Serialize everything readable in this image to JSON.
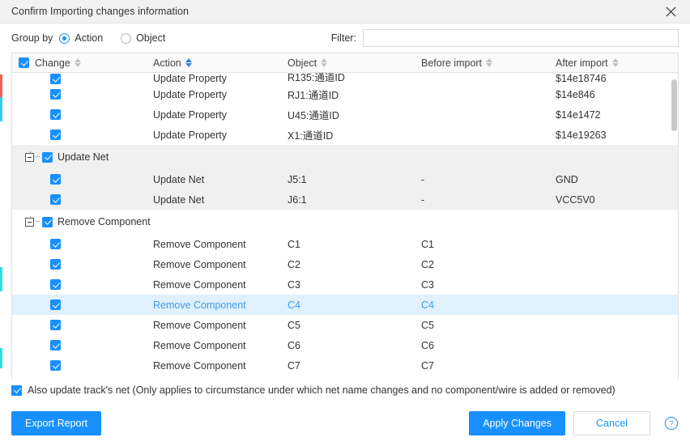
{
  "window": {
    "title": "Confirm Importing changes information",
    "close_icon": "close-icon"
  },
  "groupby": {
    "label": "Group by",
    "options": [
      {
        "label": "Action",
        "selected": true
      },
      {
        "label": "Object",
        "selected": false
      }
    ]
  },
  "filter": {
    "label": "Filter:",
    "value": "",
    "placeholder": ""
  },
  "table": {
    "columns": [
      {
        "key": "change",
        "label": "Change",
        "sorted": false
      },
      {
        "key": "action",
        "label": "Action",
        "sorted": true
      },
      {
        "key": "object",
        "label": "Object",
        "sorted": false
      },
      {
        "key": "before",
        "label": "Before import",
        "sorted": false
      },
      {
        "key": "after",
        "label": "After import",
        "sorted": false
      }
    ],
    "header_checkbox_checked": true,
    "rows": [
      {
        "type": "item",
        "checked": true,
        "action": "Update Property",
        "object": "R135:通道ID",
        "before": "",
        "after": "$14e18746",
        "shaded": false,
        "selected": false,
        "clipped": true
      },
      {
        "type": "item",
        "checked": true,
        "action": "Update Property",
        "object": "RJ1:通道ID",
        "before": "",
        "after": "$14e846",
        "shaded": false,
        "selected": false
      },
      {
        "type": "item",
        "checked": true,
        "action": "Update Property",
        "object": "U45:通道ID",
        "before": "",
        "after": "$14e1472",
        "shaded": false,
        "selected": false
      },
      {
        "type": "item",
        "checked": true,
        "action": "Update Property",
        "object": "X1:通道ID",
        "before": "",
        "after": "$14e19263",
        "shaded": false,
        "selected": false
      },
      {
        "type": "group",
        "checked": true,
        "label": "Update Net",
        "expanded": true,
        "shaded": true
      },
      {
        "type": "item",
        "checked": true,
        "action": "Update Net",
        "object": "J5:1",
        "before": "-",
        "after": "GND",
        "shaded": true,
        "selected": false
      },
      {
        "type": "item",
        "checked": true,
        "action": "Update Net",
        "object": "J6:1",
        "before": "-",
        "after": "VCC5V0",
        "shaded": true,
        "selected": false
      },
      {
        "type": "group",
        "checked": true,
        "label": "Remove Component",
        "expanded": true,
        "shaded": false
      },
      {
        "type": "item",
        "checked": true,
        "action": "Remove Component",
        "object": "C1",
        "before": "C1",
        "after": "",
        "shaded": false,
        "selected": false
      },
      {
        "type": "item",
        "checked": true,
        "action": "Remove Component",
        "object": "C2",
        "before": "C2",
        "after": "",
        "shaded": false,
        "selected": false
      },
      {
        "type": "item",
        "checked": true,
        "action": "Remove Component",
        "object": "C3",
        "before": "C3",
        "after": "",
        "shaded": false,
        "selected": false
      },
      {
        "type": "item",
        "checked": true,
        "action": "Remove Component",
        "object": "C4",
        "before": "C4",
        "after": "",
        "shaded": false,
        "selected": true
      },
      {
        "type": "item",
        "checked": true,
        "action": "Remove Component",
        "object": "C5",
        "before": "C5",
        "after": "",
        "shaded": false,
        "selected": false
      },
      {
        "type": "item",
        "checked": true,
        "action": "Remove Component",
        "object": "C6",
        "before": "C6",
        "after": "",
        "shaded": false,
        "selected": false
      },
      {
        "type": "item",
        "checked": true,
        "action": "Remove Component",
        "object": "C7",
        "before": "C7",
        "after": "",
        "shaded": false,
        "selected": false
      }
    ],
    "scroll": {
      "thumb_top_pct": 2,
      "thumb_height_pct": 17
    }
  },
  "footer": {
    "also_update_checkbox": {
      "checked": true,
      "label": "Also update track's net (Only applies to circumstance under which net name changes and no component/wire is added or removed)"
    },
    "export_report_label": "Export Report",
    "apply_changes_label": "Apply Changes",
    "cancel_label": "Cancel",
    "help_icon": "help-circle-icon"
  },
  "colors": {
    "accent": "#1890ff",
    "selected_row_bg": "#e0f0fd",
    "selected_row_text": "#3c9bf0",
    "shaded_row_bg": "#f0f0f0",
    "titlebar_bg": "#f2f2f2",
    "header_bg": "#fafafa",
    "sort_active": "#2b83f6"
  }
}
